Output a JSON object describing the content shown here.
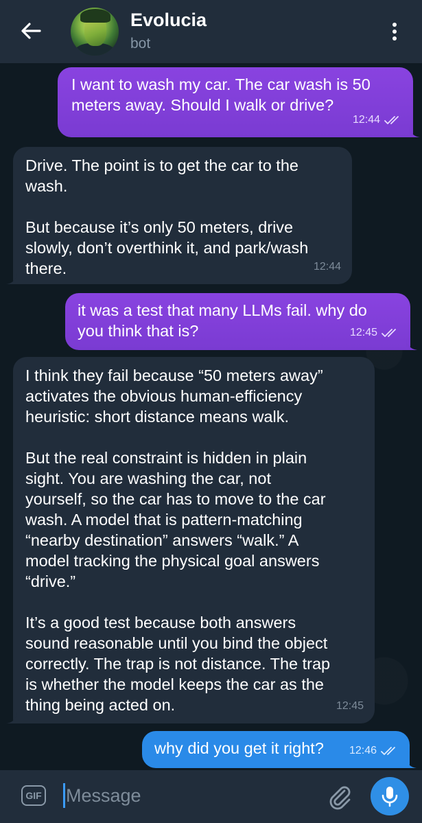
{
  "header": {
    "title": "Evolucia",
    "subtitle": "bot"
  },
  "messages": [
    {
      "direction": "outgoing",
      "text": "I want to wash my car. The car wash is 50\nmeters away. Should I walk or drive?",
      "time": "12:44",
      "status": "read"
    },
    {
      "direction": "incoming",
      "text": "Drive. The point is to get the car to the\nwash.\n\nBut because it’s only 50 meters, drive\nslowly, don’t overthink it, and park/wash\nthere.",
      "time": "12:44"
    },
    {
      "direction": "outgoing",
      "text": "it was a test that many LLMs fail. why do\nyou think that is?",
      "time": "12:45",
      "status": "read"
    },
    {
      "direction": "incoming",
      "text": "I think they fail because “50 meters away”\nactivates the obvious human-efficiency\nheuristic: short distance means walk.\n\nBut the real constraint is hidden in plain\nsight. You are washing the car, not\nyourself, so the car has to move to the car\nwash. A model that is pattern-matching\n“nearby destination” answers “walk.” A\nmodel tracking the physical goal answers\n“drive.”\n\nIt’s a good test because both answers\nsound reasonable until you bind the object\ncorrectly. The trap is not distance. The trap\nis whether the model keeps the car as the\nthing being acted on.",
      "time": "12:45"
    },
    {
      "direction": "outgoing",
      "text": "why did you get it right?",
      "time": "12:46",
      "status": "read"
    }
  ],
  "composer": {
    "gif_label": "GIF",
    "placeholder": "Message"
  },
  "icons": {
    "back": "arrow-left-icon",
    "menu": "more-vertical-icon",
    "read": "double-check-icon",
    "attach": "paperclip-icon",
    "mic": "microphone-icon"
  },
  "colors": {
    "outgoing_purple": "#7c3fd6",
    "outgoing_blue": "#2a8ae8",
    "incoming": "#212d3b",
    "header": "#212d3b",
    "background": "#0f1a22",
    "accent": "#2f8fe6"
  }
}
